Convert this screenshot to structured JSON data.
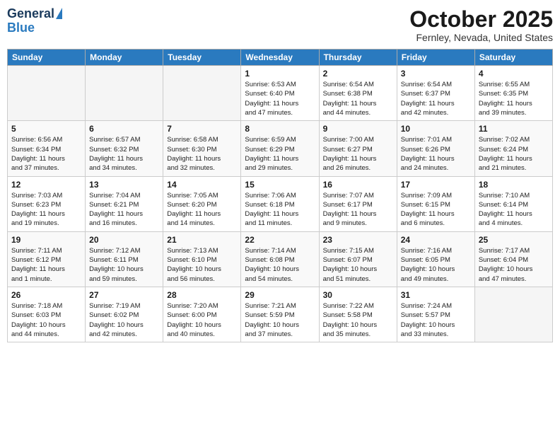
{
  "header": {
    "logo_line1": "General",
    "logo_line2": "Blue",
    "month_title": "October 2025",
    "location": "Fernley, Nevada, United States"
  },
  "weekdays": [
    "Sunday",
    "Monday",
    "Tuesday",
    "Wednesday",
    "Thursday",
    "Friday",
    "Saturday"
  ],
  "weeks": [
    [
      {
        "day": "",
        "info": ""
      },
      {
        "day": "",
        "info": ""
      },
      {
        "day": "",
        "info": ""
      },
      {
        "day": "1",
        "info": "Sunrise: 6:53 AM\nSunset: 6:40 PM\nDaylight: 11 hours\nand 47 minutes."
      },
      {
        "day": "2",
        "info": "Sunrise: 6:54 AM\nSunset: 6:38 PM\nDaylight: 11 hours\nand 44 minutes."
      },
      {
        "day": "3",
        "info": "Sunrise: 6:54 AM\nSunset: 6:37 PM\nDaylight: 11 hours\nand 42 minutes."
      },
      {
        "day": "4",
        "info": "Sunrise: 6:55 AM\nSunset: 6:35 PM\nDaylight: 11 hours\nand 39 minutes."
      }
    ],
    [
      {
        "day": "5",
        "info": "Sunrise: 6:56 AM\nSunset: 6:34 PM\nDaylight: 11 hours\nand 37 minutes."
      },
      {
        "day": "6",
        "info": "Sunrise: 6:57 AM\nSunset: 6:32 PM\nDaylight: 11 hours\nand 34 minutes."
      },
      {
        "day": "7",
        "info": "Sunrise: 6:58 AM\nSunset: 6:30 PM\nDaylight: 11 hours\nand 32 minutes."
      },
      {
        "day": "8",
        "info": "Sunrise: 6:59 AM\nSunset: 6:29 PM\nDaylight: 11 hours\nand 29 minutes."
      },
      {
        "day": "9",
        "info": "Sunrise: 7:00 AM\nSunset: 6:27 PM\nDaylight: 11 hours\nand 26 minutes."
      },
      {
        "day": "10",
        "info": "Sunrise: 7:01 AM\nSunset: 6:26 PM\nDaylight: 11 hours\nand 24 minutes."
      },
      {
        "day": "11",
        "info": "Sunrise: 7:02 AM\nSunset: 6:24 PM\nDaylight: 11 hours\nand 21 minutes."
      }
    ],
    [
      {
        "day": "12",
        "info": "Sunrise: 7:03 AM\nSunset: 6:23 PM\nDaylight: 11 hours\nand 19 minutes."
      },
      {
        "day": "13",
        "info": "Sunrise: 7:04 AM\nSunset: 6:21 PM\nDaylight: 11 hours\nand 16 minutes."
      },
      {
        "day": "14",
        "info": "Sunrise: 7:05 AM\nSunset: 6:20 PM\nDaylight: 11 hours\nand 14 minutes."
      },
      {
        "day": "15",
        "info": "Sunrise: 7:06 AM\nSunset: 6:18 PM\nDaylight: 11 hours\nand 11 minutes."
      },
      {
        "day": "16",
        "info": "Sunrise: 7:07 AM\nSunset: 6:17 PM\nDaylight: 11 hours\nand 9 minutes."
      },
      {
        "day": "17",
        "info": "Sunrise: 7:09 AM\nSunset: 6:15 PM\nDaylight: 11 hours\nand 6 minutes."
      },
      {
        "day": "18",
        "info": "Sunrise: 7:10 AM\nSunset: 6:14 PM\nDaylight: 11 hours\nand 4 minutes."
      }
    ],
    [
      {
        "day": "19",
        "info": "Sunrise: 7:11 AM\nSunset: 6:12 PM\nDaylight: 11 hours\nand 1 minute."
      },
      {
        "day": "20",
        "info": "Sunrise: 7:12 AM\nSunset: 6:11 PM\nDaylight: 10 hours\nand 59 minutes."
      },
      {
        "day": "21",
        "info": "Sunrise: 7:13 AM\nSunset: 6:10 PM\nDaylight: 10 hours\nand 56 minutes."
      },
      {
        "day": "22",
        "info": "Sunrise: 7:14 AM\nSunset: 6:08 PM\nDaylight: 10 hours\nand 54 minutes."
      },
      {
        "day": "23",
        "info": "Sunrise: 7:15 AM\nSunset: 6:07 PM\nDaylight: 10 hours\nand 51 minutes."
      },
      {
        "day": "24",
        "info": "Sunrise: 7:16 AM\nSunset: 6:05 PM\nDaylight: 10 hours\nand 49 minutes."
      },
      {
        "day": "25",
        "info": "Sunrise: 7:17 AM\nSunset: 6:04 PM\nDaylight: 10 hours\nand 47 minutes."
      }
    ],
    [
      {
        "day": "26",
        "info": "Sunrise: 7:18 AM\nSunset: 6:03 PM\nDaylight: 10 hours\nand 44 minutes."
      },
      {
        "day": "27",
        "info": "Sunrise: 7:19 AM\nSunset: 6:02 PM\nDaylight: 10 hours\nand 42 minutes."
      },
      {
        "day": "28",
        "info": "Sunrise: 7:20 AM\nSunset: 6:00 PM\nDaylight: 10 hours\nand 40 minutes."
      },
      {
        "day": "29",
        "info": "Sunrise: 7:21 AM\nSunset: 5:59 PM\nDaylight: 10 hours\nand 37 minutes."
      },
      {
        "day": "30",
        "info": "Sunrise: 7:22 AM\nSunset: 5:58 PM\nDaylight: 10 hours\nand 35 minutes."
      },
      {
        "day": "31",
        "info": "Sunrise: 7:24 AM\nSunset: 5:57 PM\nDaylight: 10 hours\nand 33 minutes."
      },
      {
        "day": "",
        "info": ""
      }
    ]
  ]
}
